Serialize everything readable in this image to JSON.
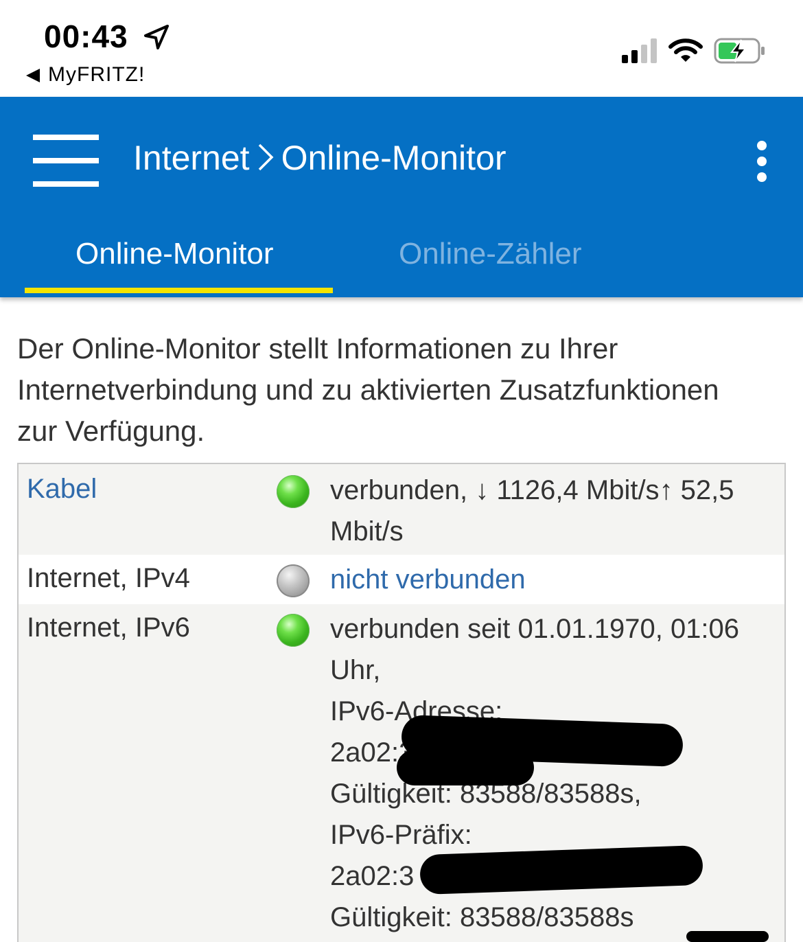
{
  "status_bar": {
    "time": "00:43",
    "back_app": "MyFRITZ!",
    "icons": [
      "location-arrow-icon",
      "cellular-signal-icon",
      "wifi-icon",
      "battery-charging-icon"
    ],
    "battery_color": "#34c759"
  },
  "header": {
    "breadcrumb_parent": "Internet",
    "breadcrumb_current": "Online-Monitor",
    "background": "#0570c4",
    "accent": "#f5e400"
  },
  "tabs": [
    {
      "label": "Online-Monitor",
      "active": true
    },
    {
      "label": "Online-Zähler",
      "active": false
    }
  ],
  "intro": {
    "line1": "Der Online-Monitor stellt Informationen zu Ihrer",
    "line2": "Internetverbindung und zu aktivierten Zusatzfunktionen",
    "line3": "zur Verfügung."
  },
  "connections": [
    {
      "label": "Kabel",
      "status": "green",
      "lines": [
        "verbunden, ↓ 1126,4 Mbit/s↑ 52,5",
        "Mbit/s"
      ]
    },
    {
      "label": "Internet, IPv4",
      "status": "grey",
      "lines": [
        "nicht verbunden"
      ]
    },
    {
      "label": "Internet, IPv6",
      "status": "green",
      "lines": [
        "verbunden seit 01.01.1970, 01:06",
        "Uhr,",
        "IPv6-Adresse:",
        "2a02:3",
        "Gültigkeit: 83588/83588s,",
        "IPv6-Präfix:",
        "2a02:3",
        "Gültigkeit: 83588/83588s"
      ]
    }
  ]
}
